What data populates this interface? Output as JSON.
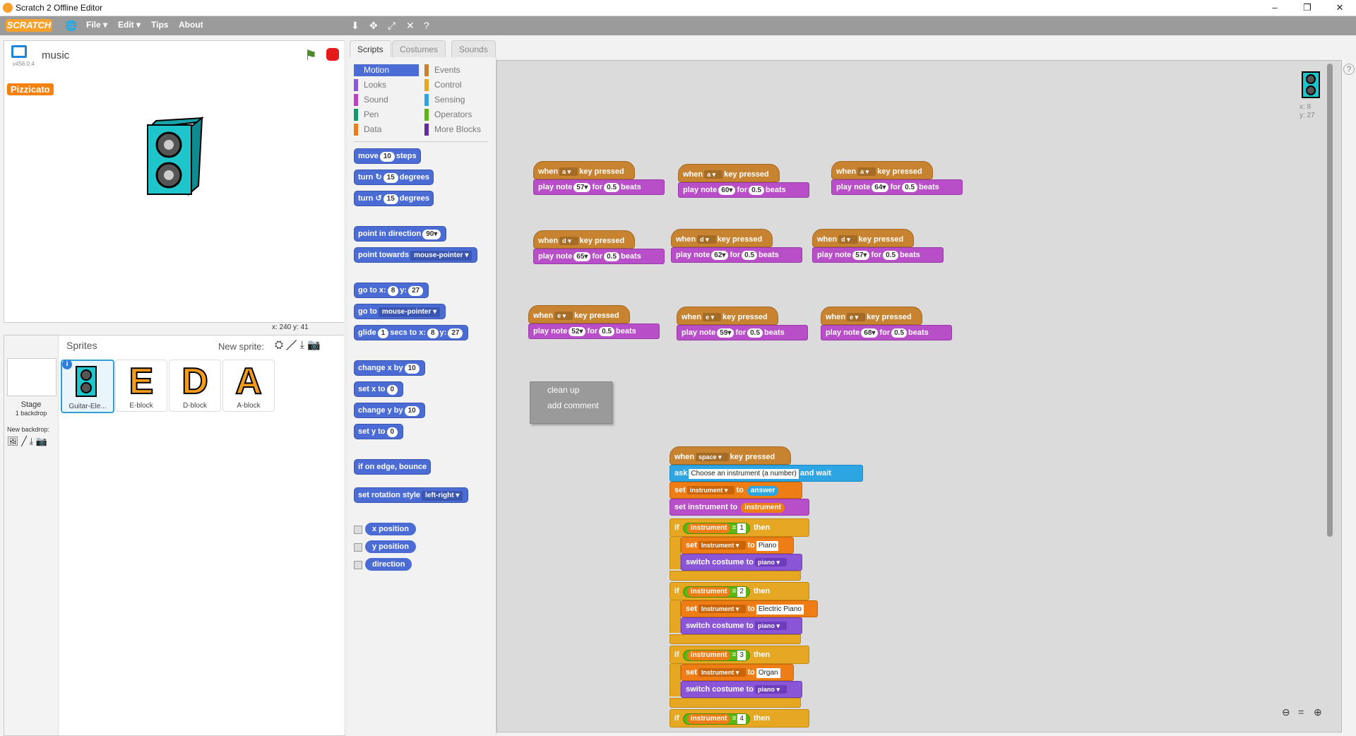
{
  "window": {
    "title": "Scratch 2 Offline Editor",
    "min": "–",
    "max": "❐",
    "close": "✕"
  },
  "menubar": {
    "logo": "SCRATCH",
    "file": "File ▾",
    "edit": "Edit ▾",
    "tips": "Tips",
    "about": "About"
  },
  "stage": {
    "project_title": "music",
    "version": "v456.0.4",
    "monitor": "Pizzicato",
    "coords": "x: 240   y: 41"
  },
  "sprites": {
    "header": "Sprites",
    "new_sprite": "New sprite:",
    "stage_label": "Stage",
    "stage_backdrops": "1 backdrop",
    "new_backdrop": "New backdrop:",
    "items": [
      {
        "label": "Guitar-Ele..."
      },
      {
        "label": "E-block",
        "letter": "E"
      },
      {
        "label": "D-block",
        "letter": "D"
      },
      {
        "label": "A-block",
        "letter": "A"
      }
    ]
  },
  "tabs": [
    "Scripts",
    "Costumes",
    "Sounds"
  ],
  "categories": {
    "left": [
      {
        "label": "Motion",
        "color": "#4a6cd4"
      },
      {
        "label": "Looks",
        "color": "#8a55d7"
      },
      {
        "label": "Sound",
        "color": "#bb42c3"
      },
      {
        "label": "Pen",
        "color": "#0e9a6c"
      },
      {
        "label": "Data",
        "color": "#ee7d16"
      }
    ],
    "right": [
      {
        "label": "Events",
        "color": "#c88330"
      },
      {
        "label": "Control",
        "color": "#e6a822"
      },
      {
        "label": "Sensing",
        "color": "#2ca5e2"
      },
      {
        "label": "Operators",
        "color": "#5cb712"
      },
      {
        "label": "More Blocks",
        "color": "#632d99"
      }
    ]
  },
  "palette": {
    "move": "move",
    "move_steps": "10",
    "move_tail": "steps",
    "turn": "turn",
    "turn_cw": "15",
    "turn_ccw": "15",
    "degrees": "degrees",
    "point_dir": "point in direction",
    "point_dir_v": "90▾",
    "point_towards": "point towards",
    "point_towards_v": "mouse-pointer ▾",
    "goto_xy": "go to x:",
    "goto_x": "8",
    "goto_y_label": "y:",
    "goto_y": "27",
    "goto": "go to",
    "goto_v": "mouse-pointer ▾",
    "glide": "glide",
    "glide_secs": "1",
    "glide_mid": "secs to x:",
    "glide_x": "8",
    "glide_y_label": "y:",
    "glide_y": "27",
    "change_x": "change x by",
    "change_x_v": "10",
    "set_x": "set x to",
    "set_x_v": "0",
    "change_y": "change y by",
    "change_y_v": "10",
    "set_y": "set y to",
    "set_y_v": "0",
    "bounce": "if on edge, bounce",
    "rot_style": "set rotation style",
    "rot_style_v": "left-right ▾",
    "xpos": "x position",
    "ypos": "y position",
    "direction": "direction"
  },
  "scripts": {
    "when": "when",
    "key_pressed": "key pressed",
    "play_note": "play note",
    "for": "for",
    "beats": "beats",
    "groups": [
      {
        "key": "a ▾",
        "note": "57▾",
        "beats": "0.5"
      },
      {
        "key": "a ▾",
        "note": "60▾",
        "beats": "0.5"
      },
      {
        "key": "a ▾",
        "note": "64▾",
        "beats": "0.5"
      },
      {
        "key": "d ▾",
        "note": "65▾",
        "beats": "0.5"
      },
      {
        "key": "d ▾",
        "note": "62▾",
        "beats": "0.5"
      },
      {
        "key": "d ▾",
        "note": "57▾",
        "beats": "0.5"
      },
      {
        "key": "e ▾",
        "note": "52▾",
        "beats": "0.5"
      },
      {
        "key": "e ▾",
        "note": "59▾",
        "beats": "0.5"
      },
      {
        "key": "e ▾",
        "note": "68▾",
        "beats": "0.5"
      }
    ],
    "context_menu": [
      "clean up",
      "add comment"
    ],
    "main": {
      "hat_key": "space ▾",
      "ask": "ask",
      "ask_text": "Choose an instrument (a number)",
      "and_wait": "and wait",
      "set": "set",
      "var": "instrument ▾",
      "to": "to",
      "answer": "answer",
      "set_instrument": "set instrument to",
      "instrument": "instrument",
      "if": "if",
      "then": "then",
      "eq": "=",
      "Instrument_var": "Instrument ▾",
      "switch_costume": "switch costume to",
      "costume": "piano ▾",
      "branches": [
        {
          "n": "1",
          "name": "Piano"
        },
        {
          "n": "2",
          "name": "Electric Piano"
        },
        {
          "n": "3",
          "name": "Organ"
        },
        {
          "n": "4",
          "name": ""
        }
      ]
    },
    "sprite_info": {
      "x": "x: 8",
      "y": "y: 27"
    }
  }
}
